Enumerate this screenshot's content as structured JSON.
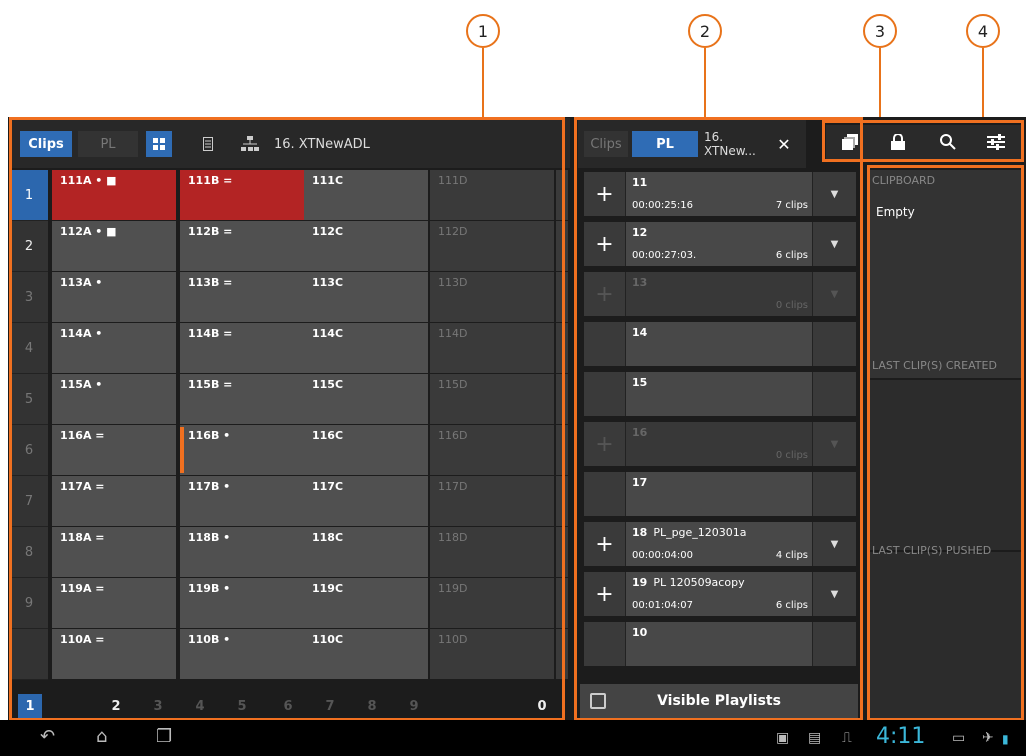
{
  "callouts": [
    "1",
    "2",
    "3",
    "4"
  ],
  "left_panel": {
    "tabs": {
      "clips": "Clips",
      "pl": "PL"
    },
    "path": "16. XTNewADL",
    "icons": [
      "grid-view-icon",
      "list-view-icon",
      "tree-view-icon"
    ],
    "row_numbers": [
      "1",
      "2",
      "3",
      "4",
      "5",
      "6",
      "7",
      "8",
      "9"
    ],
    "grid": [
      [
        "111A • ■",
        "111B =",
        "111C",
        "111D"
      ],
      [
        "112A • ■",
        "112B =",
        "112C",
        "112D"
      ],
      [
        "113A •",
        "113B =",
        "113C",
        "113D"
      ],
      [
        "114A •",
        "114B =",
        "114C",
        "114D"
      ],
      [
        "115A •",
        "115B =",
        "115C",
        "115D"
      ],
      [
        "116A =",
        "116B •",
        "116C",
        "116D"
      ],
      [
        "117A =",
        "117B •",
        "117C",
        "117D"
      ],
      [
        "118A =",
        "118B •",
        "118C",
        "118D"
      ],
      [
        "119A =",
        "119B •",
        "119C",
        "119D"
      ],
      [
        "110A =",
        "110B •",
        "110C",
        "110D"
      ]
    ],
    "pages": [
      "1",
      "2",
      "3",
      "4",
      "5",
      "6",
      "7",
      "8",
      "9",
      "0"
    ]
  },
  "playlist_panel": {
    "tabs": {
      "clips": "Clips",
      "pl": "PL",
      "path": "16. XTNew..."
    },
    "close_icon": "close-icon",
    "rows": [
      {
        "num": "11",
        "name": "",
        "time": "00:00:25:16",
        "clips": "7 clips",
        "state": "active"
      },
      {
        "num": "12",
        "name": "",
        "time": "00:00:27:03.",
        "clips": "6 clips",
        "state": "active"
      },
      {
        "num": "13",
        "name": "",
        "time": "",
        "clips": "0 clips",
        "state": "dim"
      },
      {
        "num": "14",
        "name": "",
        "time": "",
        "clips": "",
        "state": "empty"
      },
      {
        "num": "15",
        "name": "",
        "time": "",
        "clips": "",
        "state": "empty"
      },
      {
        "num": "16",
        "name": "",
        "time": "",
        "clips": "0 clips",
        "state": "dim"
      },
      {
        "num": "17",
        "name": "",
        "time": "",
        "clips": "",
        "state": "empty"
      },
      {
        "num": "18",
        "name": "PL_pge_120301a",
        "time": "00:00:04:00",
        "clips": "4 clips",
        "state": "active"
      },
      {
        "num": "19",
        "name": "PL 120509acopy",
        "time": "00:01:04:07",
        "clips": "6 clips",
        "state": "active"
      },
      {
        "num": "10",
        "name": "",
        "time": "",
        "clips": "",
        "state": "empty"
      }
    ],
    "footer": "Visible Playlists"
  },
  "toolbar": [
    "stack-icon",
    "lock-icon",
    "search-icon",
    "settings-sliders-icon"
  ],
  "clipboard": {
    "title": "CLIPBOARD",
    "content": "Empty",
    "created": "LAST CLIP(S) CREATED",
    "pushed": "LAST CLIP(S) PUSHED"
  },
  "status": {
    "time": "4:11"
  },
  "colors": {
    "accent": "#2f6cb5",
    "highlight": "#f07020",
    "clip_red": "#b32424"
  }
}
